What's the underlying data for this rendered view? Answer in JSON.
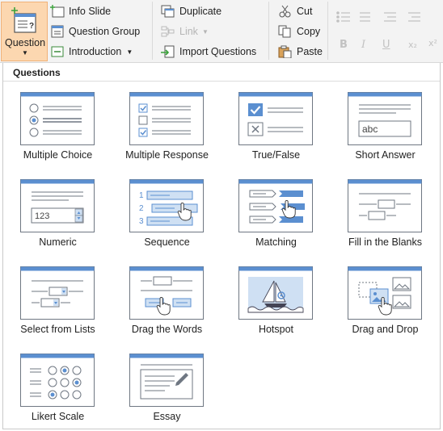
{
  "ribbon": {
    "question_label": "Question",
    "insert": {
      "info_slide": "Info Slide",
      "question_group": "Question Group",
      "introduction": "Introduction"
    },
    "slide": {
      "duplicate": "Duplicate",
      "link": "Link",
      "import_questions": "Import Questions"
    },
    "clipboard": {
      "cut": "Cut",
      "copy": "Copy",
      "paste": "Paste"
    },
    "format": {
      "bold": "B",
      "italic": "I",
      "underline": "U",
      "subscript": "x₂",
      "superscript": "x²"
    }
  },
  "panel": {
    "header": "Questions",
    "items": [
      {
        "label": "Multiple Choice",
        "icon": "multiple-choice-icon"
      },
      {
        "label": "Multiple Response",
        "icon": "multiple-response-icon"
      },
      {
        "label": "True/False",
        "icon": "true-false-icon"
      },
      {
        "label": "Short Answer",
        "icon": "short-answer-icon",
        "field_text": "abc"
      },
      {
        "label": "Numeric",
        "icon": "numeric-icon",
        "field_text": "123"
      },
      {
        "label": "Sequence",
        "icon": "sequence-icon"
      },
      {
        "label": "Matching",
        "icon": "matching-icon"
      },
      {
        "label": "Fill in the Blanks",
        "icon": "fill-in-blanks-icon"
      },
      {
        "label": "Select from Lists",
        "icon": "select-from-lists-icon"
      },
      {
        "label": "Drag the Words",
        "icon": "drag-words-icon"
      },
      {
        "label": "Hotspot",
        "icon": "hotspot-icon"
      },
      {
        "label": "Drag and Drop",
        "icon": "drag-drop-icon"
      },
      {
        "label": "Likert Scale",
        "icon": "likert-scale-icon"
      },
      {
        "label": "Essay",
        "icon": "essay-icon"
      }
    ]
  },
  "colors": {
    "accent": "#5b8fd0",
    "frame_border": "#6f7782",
    "question_button_bg": "#fcd7b0"
  }
}
